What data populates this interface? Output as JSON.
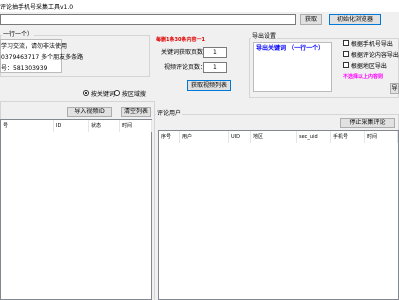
{
  "window": {
    "title": "评论抽手机号采集工具v1.0"
  },
  "top": {
    "fetch_label": "获取",
    "init_browser_label": "初始化浏览器"
  },
  "left_panel": {
    "group_title": "一行一个）",
    "info_lines": [
      "学习交流，请勿非法使用",
      "0379463717 多个朋友多条路",
      "号：581303939"
    ]
  },
  "middle_panel": {
    "notice": "每删1条30条内容一1",
    "keyword_pages_label": "关键词获取页数：",
    "keyword_pages_value": "1",
    "comment_pages_label": "视频评论页数：",
    "comment_pages_value": "1",
    "get_video_list_label": "获取视频列表"
  },
  "export_panel": {
    "group_title": "导出设置",
    "keyword_hint": "导出关键词 （一行一个）",
    "options": [
      {
        "label": "根据手机号导出",
        "checked": false
      },
      {
        "label": "根据评论内容导出",
        "checked": false
      },
      {
        "label": "根据地区导出",
        "checked": false
      }
    ],
    "notice": "不选择以上内容则",
    "button_partial": "导"
  },
  "mode": {
    "options": [
      {
        "label": "按关键词",
        "selected": true
      },
      {
        "label": "按区域搜",
        "selected": false
      }
    ]
  },
  "video_list": {
    "import_label": "导入视频ID",
    "clear_label": "清空列表",
    "columns": [
      "号",
      "ID",
      "状态",
      "时间"
    ]
  },
  "comments": {
    "group_title": "评论用户",
    "stop_label": "停止采集评论",
    "columns": [
      "序号",
      "用户",
      "UID",
      "地区",
      "sec_uid",
      "手机号",
      "时间"
    ]
  }
}
